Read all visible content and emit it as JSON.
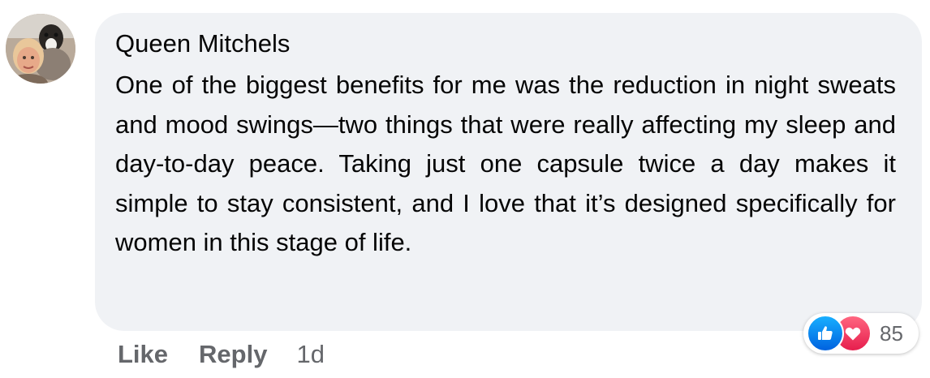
{
  "comment": {
    "author": "Queen Mitchels",
    "text": "One of the biggest benefits for me was the reduction in night sweats and mood swings—two things that were really affecting my sleep and day-to-day peace. Taking just one capsule twice a day makes it simple to stay consistent, and I love that it’s designed specifically for women in this stage of life.",
    "avatar_icon": "profile-photo"
  },
  "reactions": {
    "icons": [
      "like-icon",
      "love-icon"
    ],
    "count": "85",
    "like_color": "#1877f2",
    "love_color": "#f33e58"
  },
  "actions": {
    "like_label": "Like",
    "reply_label": "Reply",
    "timestamp": "1d"
  },
  "colors": {
    "bubble_background": "#f0f2f5",
    "text": "#050505",
    "secondary_text": "#65676b"
  }
}
